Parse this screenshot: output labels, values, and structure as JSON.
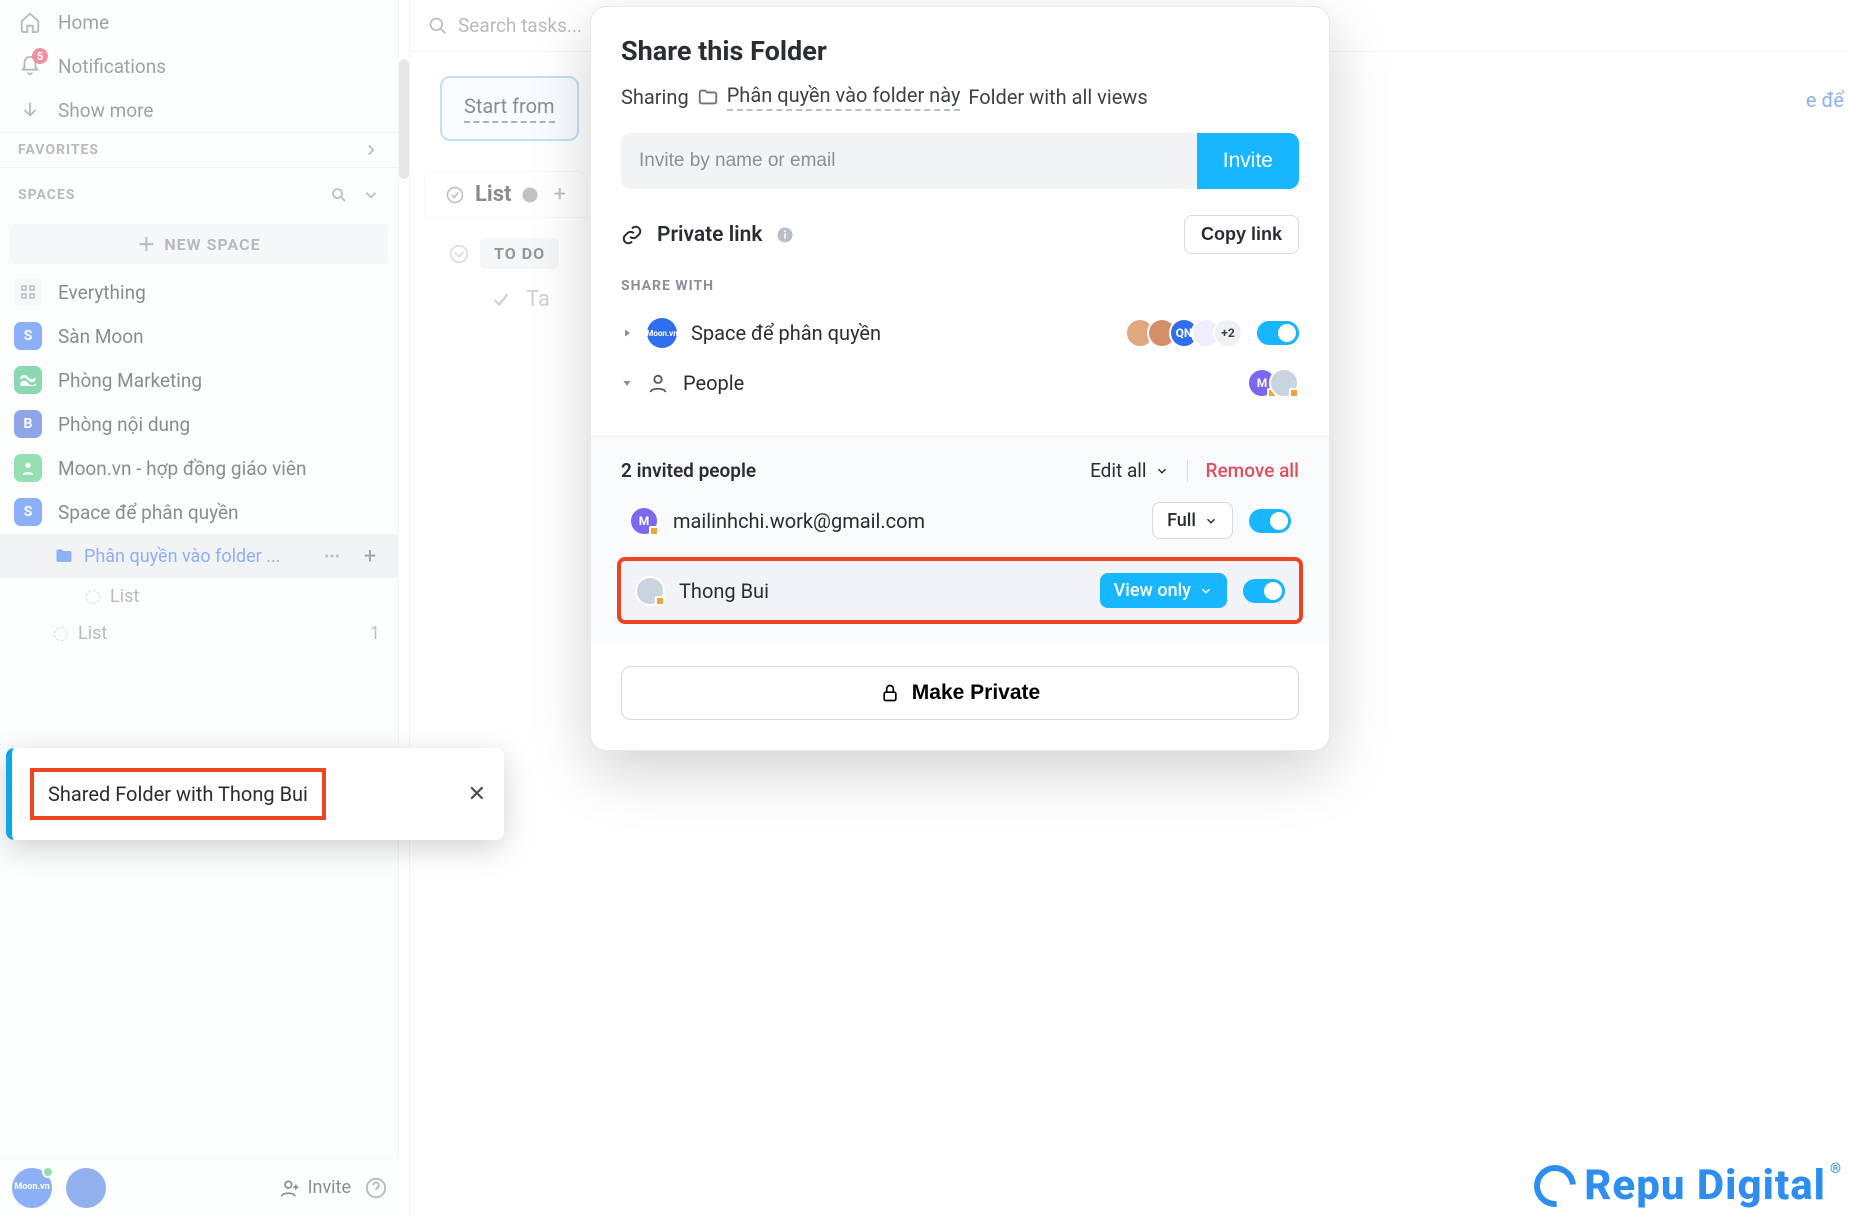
{
  "sidebar": {
    "home": "Home",
    "notifications": {
      "label": "Notifications",
      "badge": "5"
    },
    "show_more": "Show more",
    "favorites_header": "FAVORITES",
    "spaces_header": "SPACES",
    "new_space": "NEW SPACE",
    "everything": "Everything",
    "spaces": [
      {
        "label": "Sàn Moon",
        "color": "#2f6fed",
        "initial": "S"
      },
      {
        "label": "Phòng Marketing",
        "color": "#2bb673",
        "initial": "≈"
      },
      {
        "label": "Phòng nội dung",
        "color": "#355bd4",
        "initial": "B"
      },
      {
        "label": "Moon.vn - hợp đồng giáo viên",
        "color": "#3ac76d",
        "initial": "👤"
      },
      {
        "label": "Space để phân quyền",
        "color": "#2f6fed",
        "initial": "S"
      }
    ],
    "active_folder": "Phân quyền vào folder ...",
    "list1": "List",
    "list2": {
      "label": "List",
      "count": "1"
    }
  },
  "main": {
    "search_placeholder": "Search tasks...",
    "template_cta": "Start from",
    "list_tab": "List",
    "status": "TO DO",
    "task_placeholder": "Ta"
  },
  "truncated": "e để",
  "modal": {
    "title": "Share this Folder",
    "sharing_label": "Sharing",
    "folder_name": "Phân quyền vào folder này",
    "folder_suffix": "Folder with all views",
    "invite_placeholder": "Invite by name or email",
    "invite_btn": "Invite",
    "private_link": "Private link",
    "copy_link": "Copy link",
    "share_with": "SHARE WITH",
    "space_share": "Space để phân quyền",
    "plus_count": "+2",
    "people_label": "People",
    "invited_count": "2 invited people",
    "edit_all": "Edit all",
    "remove_all": "Remove all",
    "person1": {
      "name": "mailinhchi.work@gmail.com",
      "perm": "Full",
      "avatar": "M",
      "color": "#7b68ee"
    },
    "person2": {
      "name": "Thong Bui",
      "perm": "View only"
    },
    "make_private": "Make Private"
  },
  "toast": {
    "text": "Shared Folder with Thong Bui"
  },
  "bottombar": {
    "invite": "Invite"
  },
  "brand": {
    "text": "Repu Digital"
  }
}
